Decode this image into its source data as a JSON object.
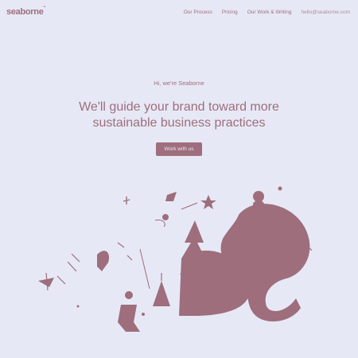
{
  "nav": {
    "logo": "seaborne",
    "links": [
      "Our Process",
      "Pricing",
      "Our Work & Writing"
    ],
    "contact": "hello@seaborne.com"
  },
  "hero": {
    "eyebrow": "Hi, we're Seaborne",
    "headline": "We'll guide your brand toward more sustainable business practices",
    "cta": "Work with us"
  },
  "colors": {
    "background": "#e7e8f5",
    "accent": "#9e6e7c"
  }
}
